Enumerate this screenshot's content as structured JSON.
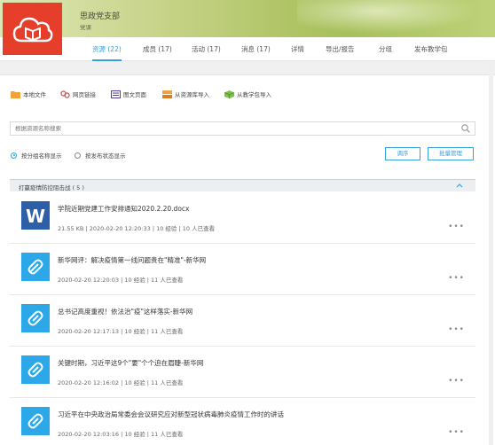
{
  "colors": {
    "accent": "#3aa0d8",
    "logo_bg": "#e53f2b",
    "link_icon_bg": "#2ca7e8",
    "word_icon_bg": "#2d5fa8"
  },
  "group": {
    "title": "思政党支部",
    "subtitle": "党课"
  },
  "tabs": [
    {
      "label": "资源 (22)",
      "active": true
    },
    {
      "label": "成员 (17)"
    },
    {
      "label": "活动 (17)"
    },
    {
      "label": "消息 (17)"
    },
    {
      "label": "详情"
    },
    {
      "label": "导出/报告"
    },
    {
      "label": "分组"
    },
    {
      "label": "发布教学包"
    }
  ],
  "toolbar": [
    {
      "label": "本地文件",
      "icon": "folder-icon"
    },
    {
      "label": "网页链接",
      "icon": "link-icon"
    },
    {
      "label": "图文页面",
      "icon": "page-icon"
    },
    {
      "label": "从资源库导入",
      "icon": "library-import-icon"
    },
    {
      "label": "从教学包导入",
      "icon": "package-import-icon"
    }
  ],
  "search": {
    "placeholder": "根据资源名称搜索"
  },
  "view_options": {
    "by_group": "按分组名称显示",
    "by_status": "按发布状态显示"
  },
  "buttons": {
    "sort": "调序",
    "batch": "批量管理"
  },
  "section": {
    "title": "打赢疫情防控阻击战 ( 5 )"
  },
  "items": [
    {
      "type": "word",
      "title": "学院近期党建工作安排通知2020.2.20.docx",
      "meta": "21.55 KB  |  2020-02-20 12:20:33  |  10 经验  |  10 人已查看"
    },
    {
      "type": "link",
      "title": "新华网评：解决疫情第一线问题贵在\"精准\"-新华网",
      "meta": "2020-02-20 12:20:03  |  10 经验  |  11 人已查看"
    },
    {
      "type": "link",
      "title": "总书记高度重视！依法治\"疫\"这样落实-新华网",
      "meta": "2020-02-20 12:17:13  |  10 经验  |  11 人已查看"
    },
    {
      "type": "link",
      "title": "关键时期，习近平这9个\"要\"个个迫在眉睫-新华网",
      "meta": "2020-02-20 12:16:02  |  10 经验  |  11 人已查看"
    },
    {
      "type": "link",
      "title": "习近平在中央政治局常委会会议研究应对新型冠状病毒肺炎疫情工作时的讲话",
      "meta": "2020-02-20 12:03:16  |  10 经验  |  11 人已查看"
    }
  ],
  "more_glyph": "•••"
}
